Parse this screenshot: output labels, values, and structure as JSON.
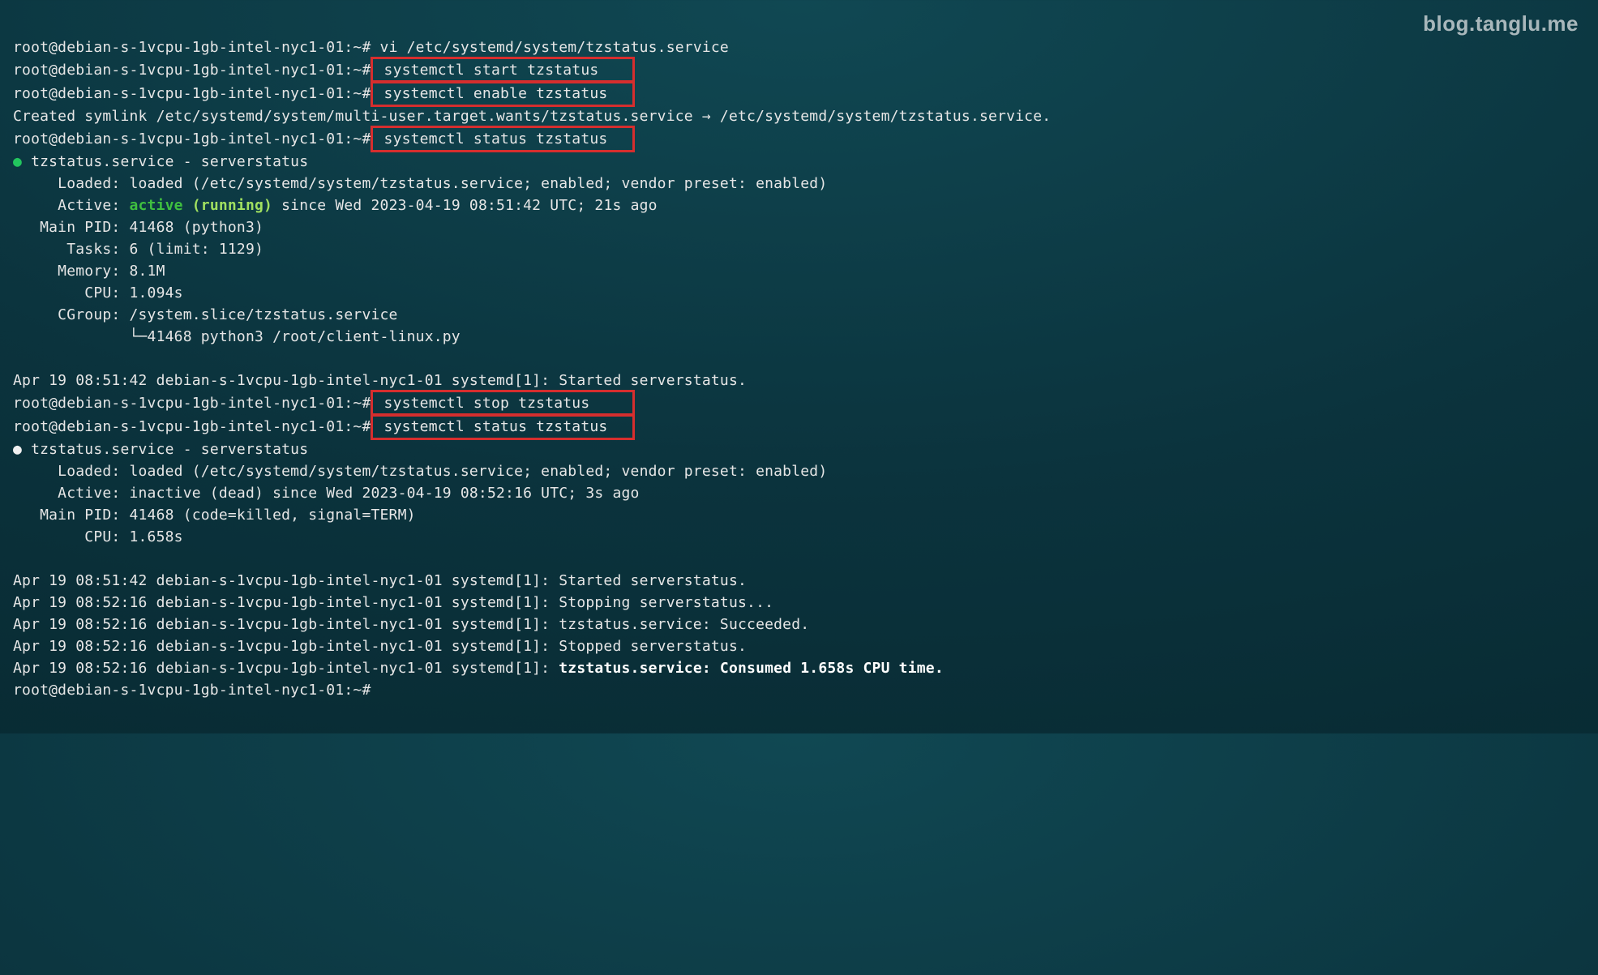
{
  "watermark": "blog.tanglu.me",
  "prompt": "root@debian-s-1vcpu-1gb-intel-nyc1-01:~#",
  "cmds": {
    "vi": "vi /etc/systemd/system/tzstatus.service",
    "start": "systemctl start tzstatus",
    "enable": "systemctl enable tzstatus",
    "status": "systemctl status tzstatus",
    "stop": "systemctl stop tzstatus"
  },
  "out": {
    "symlink": "Created symlink /etc/systemd/system/multi-user.target.wants/tzstatus.service → /etc/systemd/system/tzstatus.service.",
    "bullet": "●",
    "svc_line": " tzstatus.service - serverstatus",
    "loaded": "     Loaded: loaded (/etc/systemd/system/tzstatus.service; enabled; vendor preset: enabled)",
    "active_label": "     Active: ",
    "active_text": "active (running)",
    "active_rest": " since Wed 2023-04-19 08:51:42 UTC; 21s ago",
    "main_pid": "   Main PID: 41468 (python3)",
    "tasks": "      Tasks: 6 (limit: 1129)",
    "memory": "     Memory: 8.1M",
    "cpu1": "        CPU: 1.094s",
    "cgroup_line": "     CGroup: /system.slice/tzstatus.service",
    "cgroup_child": "             └─41468 python3 /root/client-linux.py",
    "log1": "Apr 19 08:51:42 debian-s-1vcpu-1gb-intel-nyc1-01 systemd[1]: Started serverstatus.",
    "inactive_label": "     Active: inactive (dead) since Wed 2023-04-19 08:52:16 UTC; 3s ago",
    "main_pid2": "   Main PID: 41468 (code=killed, signal=TERM)",
    "cpu2": "        CPU: 1.658s",
    "log2": "Apr 19 08:51:42 debian-s-1vcpu-1gb-intel-nyc1-01 systemd[1]: Started serverstatus.",
    "log3": "Apr 19 08:52:16 debian-s-1vcpu-1gb-intel-nyc1-01 systemd[1]: Stopping serverstatus...",
    "log4": "Apr 19 08:52:16 debian-s-1vcpu-1gb-intel-nyc1-01 systemd[1]: tzstatus.service: Succeeded.",
    "log5": "Apr 19 08:52:16 debian-s-1vcpu-1gb-intel-nyc1-01 systemd[1]: Stopped serverstatus.",
    "log6_prefix": "Apr 19 08:52:16 debian-s-1vcpu-1gb-intel-nyc1-01 systemd[1]: ",
    "log6_bold": "tzstatus.service: Consumed 1.658s CPU time."
  }
}
